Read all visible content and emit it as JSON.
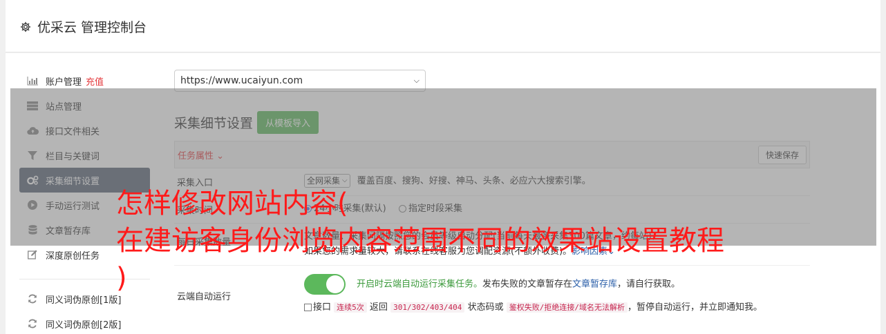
{
  "header": {
    "title": "优采云 管理控制台"
  },
  "sidebar": {
    "items": [
      {
        "label": "账户管理",
        "extra": "充值",
        "icon": "bar-chart-icon"
      },
      {
        "label": "站点管理",
        "icon": "server-icon"
      },
      {
        "label": "接口文件相关",
        "icon": "cloud-upload-icon"
      },
      {
        "label": "栏目与关键词",
        "icon": "filter-icon"
      },
      {
        "label": "采集细节设置",
        "icon": "gears-icon",
        "active": true
      },
      {
        "label": "手动运行测试",
        "icon": "play-icon"
      },
      {
        "label": "文章暂存库",
        "icon": "database-icon"
      },
      {
        "label": "深度原创任务",
        "icon": "edit-icon"
      },
      {
        "label": "同义词伪原创[1版]",
        "icon": "refresh-icon"
      },
      {
        "label": "同义词伪原创[2版]",
        "icon": "refresh-icon"
      }
    ]
  },
  "site_select": {
    "value": "https://www.ucaiyun.com"
  },
  "section": {
    "title": "采集细节设置",
    "import_button": "从模板导入",
    "task_attr": "任务属性",
    "quick_save": "快速保存"
  },
  "rows": {
    "entry": {
      "label": "采集入口",
      "select": "全网采集",
      "desc": "覆盖百度、搜狗、好搜、神马、头条、必应六大搜索引擎。"
    },
    "time": {
      "label": "采集时间",
      "option1": "24小时采集(默认)",
      "option2": "指定时段采集"
    },
    "limit": {
      "label": "每日采集数量",
      "line1": "文章数量、采集间隔按照您的会员等级自动分配(当前每天最多采集300篇文章，约每站)，",
      "line2": "如果您的需求量较大，请联系在线客服为您调配资源(不额外收费)。",
      "link": "影响因素"
    },
    "cloud": {
      "label": "云端自动运行",
      "status": "开启时云端自动运行采集任务。",
      "text1": "发布失败的文章暂存在",
      "link": "文章暂存库",
      "text2": "，请自行获取。",
      "check_prefix": "接口",
      "code1": "连续5次",
      "mid1": "返回",
      "code2": "301/302/403/404",
      "mid2": "状态码或",
      "code3": "鉴权失败/拒绝连接/域名无法解析",
      "tail": "，暂停自动运行，并立即通知我。"
    }
  },
  "overlay_headline": "怎样修改网站内容(\n在建访客身份浏览内容范围不同的效果站设置教程\n)",
  "colors": {
    "active_bg": "#5a6577",
    "accent_green": "#5cb85c",
    "red": "#e4393c",
    "headline": "#ff1a1a"
  }
}
